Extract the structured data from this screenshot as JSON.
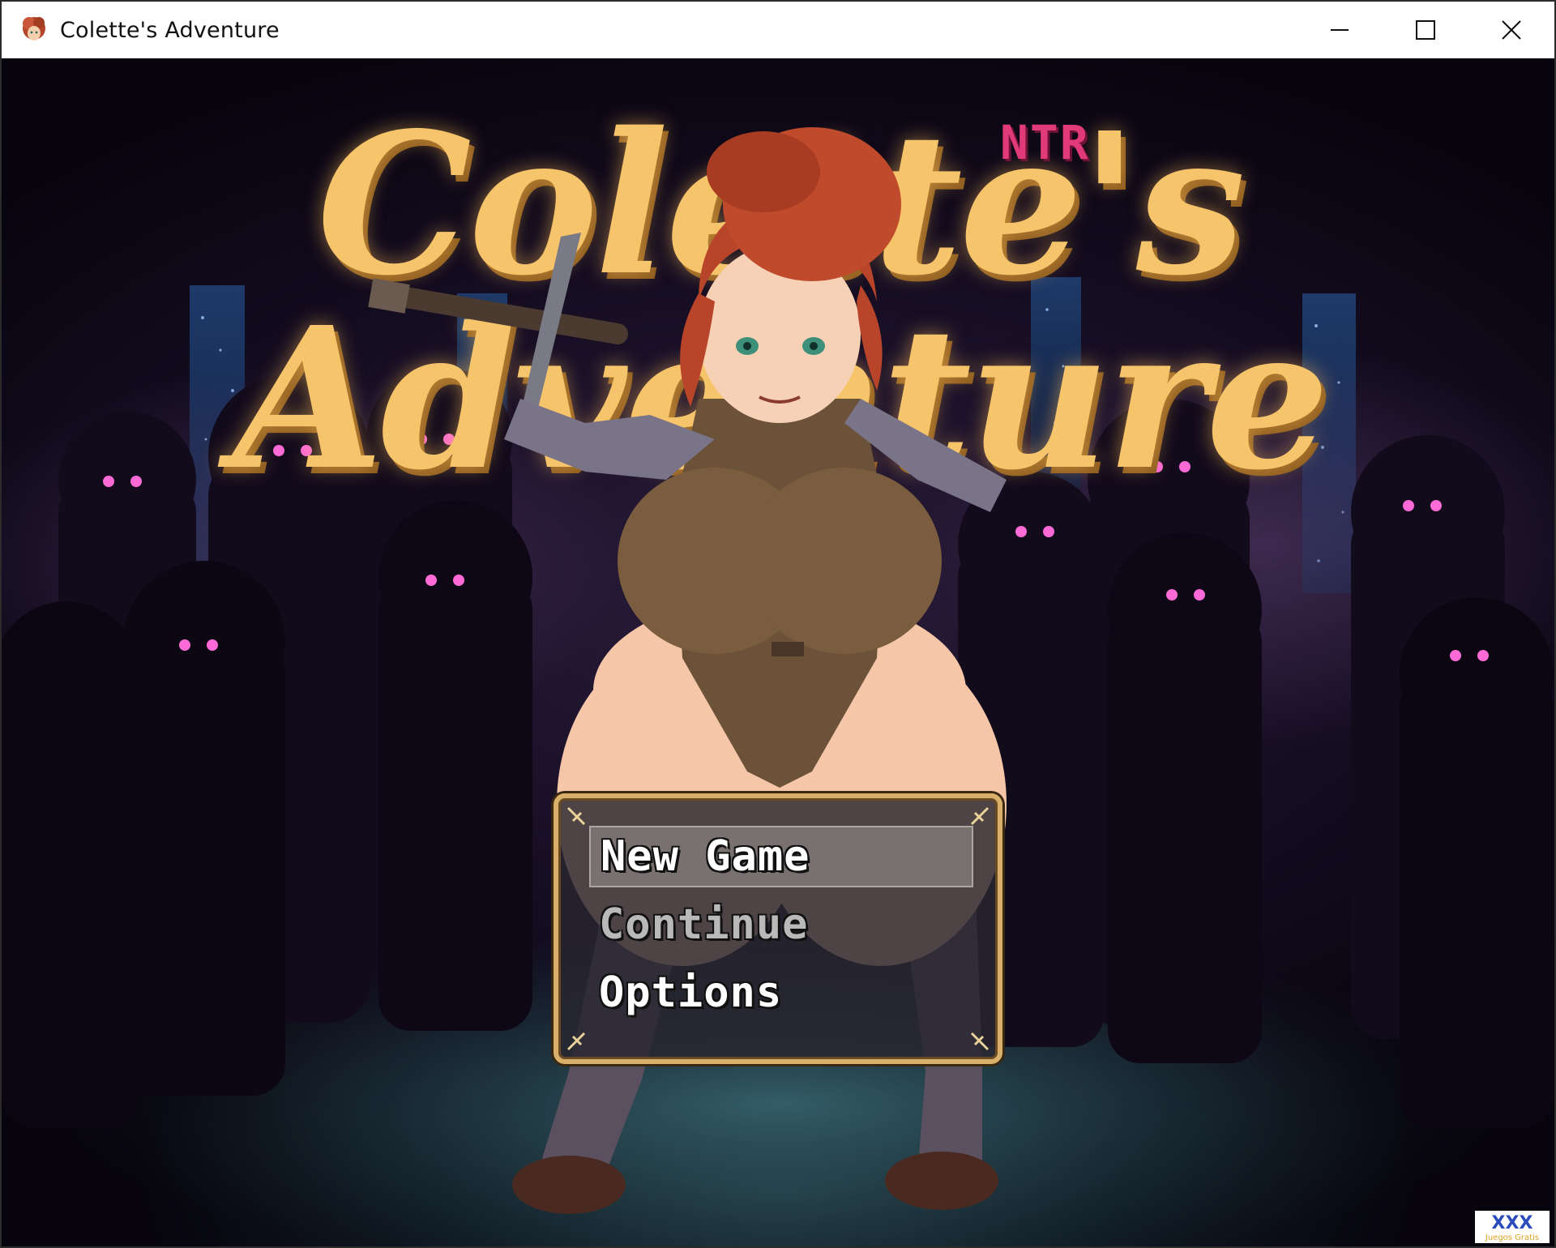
{
  "window": {
    "title": "Colette's Adventure",
    "controls": [
      "minimize-icon",
      "maximize-icon",
      "close-icon"
    ]
  },
  "logo": {
    "title": "Colette's Adventure",
    "tag": "NTR",
    "color": "#f6c46b",
    "tag_color": "#e03a78"
  },
  "menu": {
    "items": [
      {
        "label": "New Game",
        "state": "selected"
      },
      {
        "label": "Continue",
        "state": "disabled"
      },
      {
        "label": "Options",
        "state": "normal"
      }
    ],
    "frame_color": "#d9b06a"
  },
  "watermark": {
    "text": "XXX",
    "subtext": "Juegos Gratis"
  }
}
